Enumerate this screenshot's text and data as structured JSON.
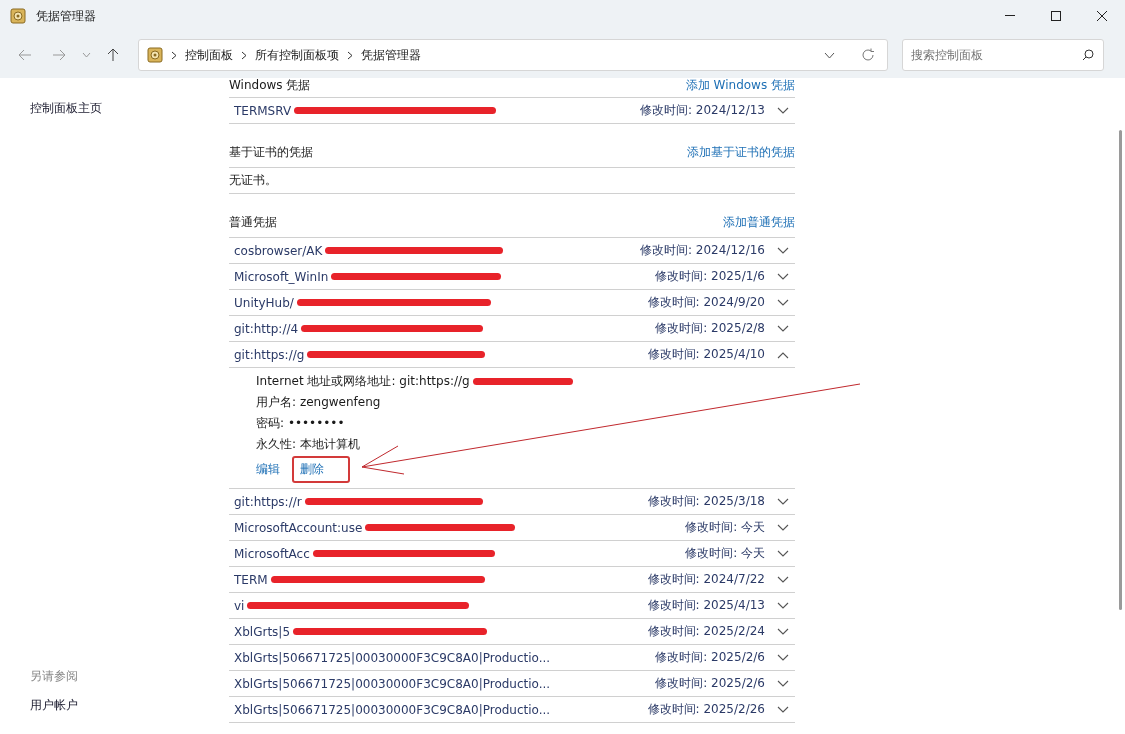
{
  "window": {
    "title": "凭据管理器"
  },
  "address_bar": {
    "breadcrumbs": [
      "控制面板",
      "所有控制面板项",
      "凭据管理器"
    ]
  },
  "search": {
    "placeholder": "搜索控制面板"
  },
  "sidebar": {
    "items": [
      "控制面板主页"
    ],
    "see_also_heading": "另请参阅",
    "see_also": [
      "用户帐户"
    ]
  },
  "sections": [
    {
      "title": "Windows 凭据",
      "action": "添加 Windows 凭据",
      "items": [
        {
          "name": "TERMSRV",
          "redacted": true,
          "modified_label": "修改时间:",
          "modified": "2024/12/13",
          "expanded": false
        }
      ]
    },
    {
      "title": "基于证书的凭据",
      "action": "添加基于证书的凭据",
      "empty_text": "无证书。"
    },
    {
      "title": "普通凭据",
      "action": "添加普通凭据",
      "items": [
        {
          "name": "cosbrowser/AK",
          "redacted": true,
          "modified_label": "修改时间:",
          "modified": "2024/12/16",
          "expanded": false
        },
        {
          "name": "Microsoft_WinIn",
          "redacted": true,
          "modified_label": "修改时间:",
          "modified": "2025/1/6",
          "expanded": false
        },
        {
          "name": "UnityHub/",
          "redacted": true,
          "modified_label": "修改时间:",
          "modified": "2024/9/20",
          "expanded": false
        },
        {
          "name": "git:http://4",
          "redacted": true,
          "modified_label": "修改时间:",
          "modified": "2025/2/8",
          "expanded": false
        },
        {
          "name": "git:https://g",
          "redacted": true,
          "modified_label": "修改时间:",
          "modified": "2025/4/10",
          "expanded": true,
          "details": {
            "address_label": "Internet 地址或网络地址:",
            "address": "git:https://g",
            "address_redacted": true,
            "user_label": "用户名:",
            "user": "zengwenfeng",
            "password_label": "密码:",
            "password": "••••••••",
            "persistence_label": "永久性:",
            "persistence": "本地计算机",
            "edit": "编辑",
            "delete": "删除",
            "delete_highlighted": true
          }
        },
        {
          "name": "git:https://r",
          "redacted": true,
          "modified_label": "修改时间:",
          "modified": "2025/3/18",
          "expanded": false
        },
        {
          "name": "MicrosoftAccount:use",
          "redacted": true,
          "modified_label": "修改时间:",
          "modified": "今天",
          "expanded": false
        },
        {
          "name": "MicrosoftAcc",
          "redacted": true,
          "modified_label": "修改时间:",
          "modified": "今天",
          "expanded": false
        },
        {
          "name": "TERM",
          "redacted": true,
          "modified_label": "修改时间:",
          "modified": "2024/7/22",
          "expanded": false
        },
        {
          "name": "vi",
          "redacted": true,
          "modified_label": "修改时间:",
          "modified": "2025/4/13",
          "expanded": false
        },
        {
          "name": "XblGrts|5",
          "redacted": true,
          "modified_label": "修改时间:",
          "modified": "2025/2/24",
          "expanded": false
        },
        {
          "name": "XblGrts|506671725|00030000F3C9C8A0|Productio...",
          "redacted": false,
          "modified_label": "修改时间:",
          "modified": "2025/2/6",
          "expanded": false
        },
        {
          "name": "XblGrts|506671725|00030000F3C9C8A0|Productio...",
          "redacted": false,
          "modified_label": "修改时间:",
          "modified": "2025/2/6",
          "expanded": false
        },
        {
          "name": "XblGrts|506671725|00030000F3C9C8A0|Productio...",
          "redacted": false,
          "modified_label": "修改时间:",
          "modified": "2025/2/26",
          "expanded": false
        }
      ]
    }
  ]
}
